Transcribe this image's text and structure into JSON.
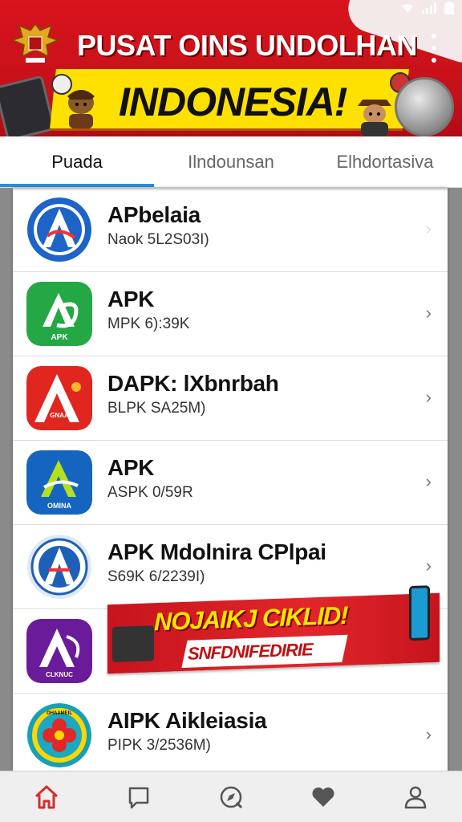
{
  "status_bar": {
    "icons": [
      "wifi-icon",
      "signal-icon",
      "battery-icon"
    ]
  },
  "header": {
    "title_top": "PUSAT OINS UNDOLHAN",
    "title_main": "INDONESIA!",
    "menu_icon": "more-vert-icon",
    "colors": {
      "red": "#d8141c",
      "yellow": "#ffe100"
    }
  },
  "tabs": [
    {
      "label": "Puada",
      "active": true
    },
    {
      "label": "Ilndounsan",
      "active": false
    },
    {
      "label": "Elhdortasiva",
      "active": false
    }
  ],
  "apps": [
    {
      "name": "APbelaia",
      "meta": "Naok 5L2S03I)",
      "icon": "blue-a-icon"
    },
    {
      "name": "APK",
      "meta": "MPK 6):39K",
      "icon": "green-a-icon",
      "icon_label": "APK"
    },
    {
      "name": "DAPK: lXbnrbah",
      "meta": "BLPK SA25M)",
      "icon": "red-a-icon",
      "icon_label": "GNAA"
    },
    {
      "name": "APK",
      "meta": "ASPK 0/59R",
      "icon": "blue-green-a-icon",
      "icon_label": "OMINA"
    },
    {
      "name": "APK Mdolnira CPlpai",
      "meta": "S69K 6/2239I)",
      "icon": "emblem-a-icon"
    },
    {
      "name": "",
      "meta": "",
      "icon": "purple-a-icon",
      "icon_label": "CLKNUC"
    },
    {
      "name": "AIPK Aikleiasia",
      "meta": "PIPK 3/2536M)",
      "icon": "flower-icon",
      "icon_label": "OHAAMEIL"
    }
  ],
  "ad": {
    "title": "NOJAIKJ CIKLID!",
    "subtitle": "SNFDNIFEDIRIE"
  },
  "bottom_nav": [
    {
      "name": "home",
      "icon": "home-icon",
      "active": true
    },
    {
      "name": "messages",
      "icon": "message-icon"
    },
    {
      "name": "explore",
      "icon": "compass-icon"
    },
    {
      "name": "favorites",
      "icon": "heart-icon"
    },
    {
      "name": "profile",
      "icon": "user-icon"
    }
  ]
}
